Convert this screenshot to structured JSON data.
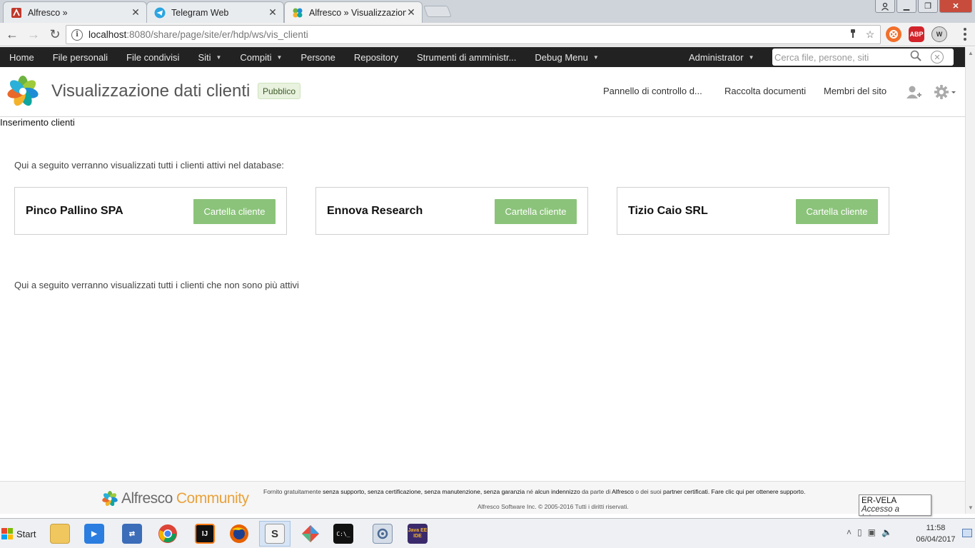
{
  "browser": {
    "tabs": [
      {
        "title": "Alfresco »",
        "icon": "alfresco-old-icon"
      },
      {
        "title": "Telegram Web",
        "icon": "telegram-icon"
      },
      {
        "title": "Alfresco » Visualizzazione",
        "icon": "alfresco-icon"
      }
    ],
    "active_tab": 2,
    "url_host": "localhost",
    "url_rest": ":8080/share/page/site/er/hdp/ws/vis_clienti",
    "extensions": [
      "avast-icon",
      "adblock-icon",
      "w-icon"
    ],
    "ext_labels": {
      "abp": "ABP",
      "w": "W"
    }
  },
  "topnav": {
    "items": [
      {
        "label": "Home",
        "caret": false
      },
      {
        "label": "File personali",
        "caret": false
      },
      {
        "label": "File condivisi",
        "caret": false
      },
      {
        "label": "Siti",
        "caret": true
      },
      {
        "label": "Compiti",
        "caret": true
      },
      {
        "label": "Persone",
        "caret": false
      },
      {
        "label": "Repository",
        "caret": false
      },
      {
        "label": "Strumenti di amministr...",
        "caret": false
      },
      {
        "label": "Debug Menu",
        "caret": true
      }
    ],
    "user": "Administrator",
    "search_placeholder": "Cerca file, persone, siti"
  },
  "site": {
    "title": "Visualizzazione dati clienti",
    "visibility": "Pubblico",
    "nav": {
      "dashboard": "Pannello di controllo d...",
      "library": "Raccolta documenti",
      "members": "Membri del sito"
    }
  },
  "content": {
    "subtitle": "Inserimento clienti",
    "intro": "Qui a seguito verranno visualizzati tutti i clienti attivi nel database:",
    "clients": [
      {
        "name": "Pinco Pallino SPA",
        "button": "Cartella cliente"
      },
      {
        "name": "Ennova Research",
        "button": "Cartella cliente"
      },
      {
        "name": "Tizio Caio SRL",
        "button": "Cartella cliente"
      }
    ],
    "inactive_intro": "Qui a seguito verranno visualizzati tutti i clienti che non sono più attivi"
  },
  "footer": {
    "brand": "Alfresco",
    "edition": "Community",
    "line1_a": "Fornito gratuitamente ",
    "line1_b": "senza supporto, senza certificazione, senza manutenzione, senza garanzia",
    "line1_c": " né ",
    "line1_d": "alcun indennizzo",
    "line1_e": " da parte di ",
    "line1_f": "Alfresco",
    "line1_g": " o dei suoi ",
    "line1_h": "partner certificati. Fare clic qui per ottenere supporto.",
    "copyright": "Alfresco Software Inc. © 2005-2016 Tutti i diritti riservati."
  },
  "tooltip": {
    "title": "ER-VELA",
    "subtitle": "Accesso a Internet"
  },
  "taskbar": {
    "start_label": "Start",
    "apps": [
      "explorer-icon",
      "media-player-icon",
      "network-icon",
      "chrome-icon",
      "intellij-icon",
      "firefox-icon",
      "slack-icon",
      "sourcetree-icon",
      "terminal-icon",
      "control-panel-icon",
      "eclipse-javaee-icon"
    ],
    "app_labels": {
      "intellij": "IJ",
      "slack": "S",
      "terminal": "C:\\_",
      "javaee": "Java EE IDE"
    },
    "time": "11:58",
    "date": "06/04/2017"
  },
  "colors": {
    "header_bg": "#222222",
    "button_green": "#8bc37a",
    "badge_bg": "#e8f2de",
    "community_orange": "#e9a23b"
  }
}
